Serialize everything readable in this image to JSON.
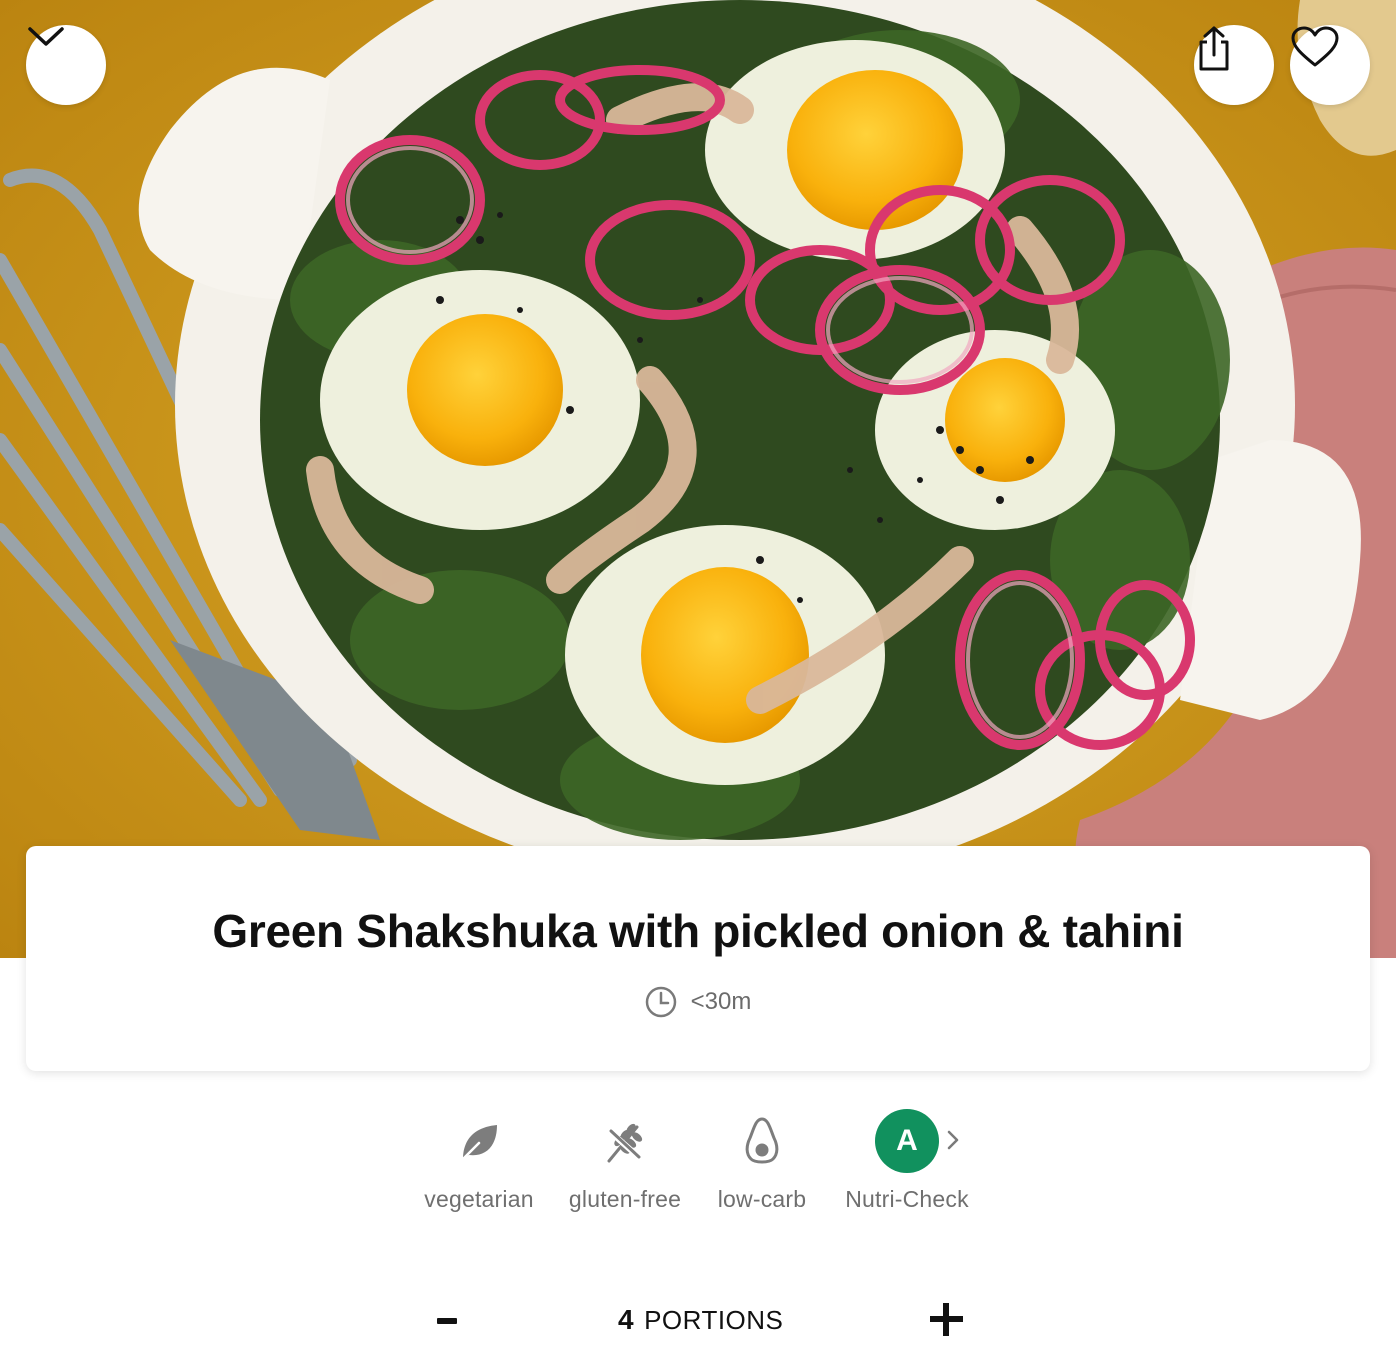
{
  "header": {
    "collapse_icon": "chevron-down-icon",
    "share_icon": "share-icon",
    "favorite_icon": "heart-icon"
  },
  "recipe": {
    "title": "Green Shakshuka with pickled onion & tahini",
    "time_icon": "clock-icon",
    "time": "<30m"
  },
  "tags": [
    {
      "icon": "leaf-icon",
      "label": "vegetarian"
    },
    {
      "icon": "wheat-crossed-icon",
      "label": "gluten-free"
    },
    {
      "icon": "avocado-icon",
      "label": "low-carb"
    },
    {
      "icon": "nutri-check-badge",
      "label": "Nutri-Check",
      "badge": "A",
      "badge_color": "#11915e"
    }
  ],
  "portions": {
    "count": "4",
    "label": "PORTIONS",
    "decrease_label": "-",
    "increase_label": "+"
  },
  "colors": {
    "tablecloth": "#d29a1c",
    "dish": "#f4f1ea",
    "nutri_green": "#11915e",
    "muted_text": "#6f6f6f"
  }
}
